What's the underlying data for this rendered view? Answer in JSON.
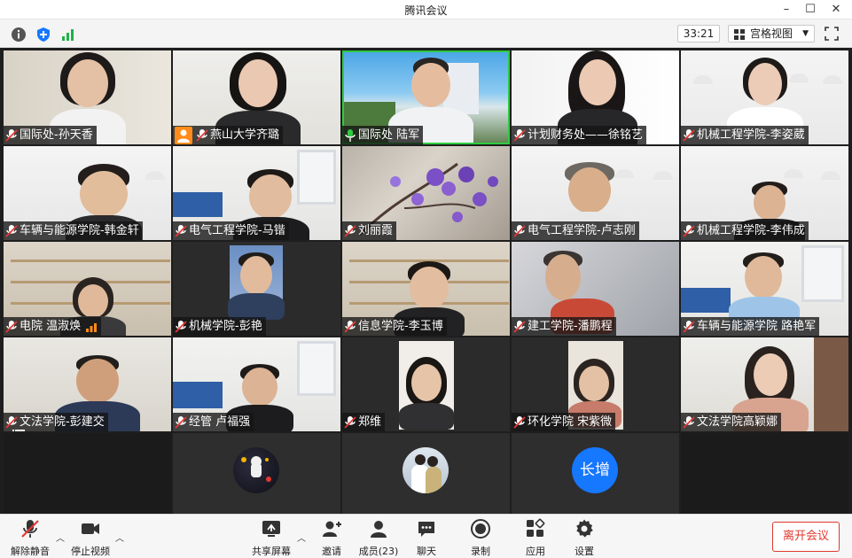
{
  "window": {
    "title": "腾讯会议"
  },
  "toolbar": {
    "timer": "33:21",
    "view_label": "宫格视图",
    "icons": [
      "info-icon",
      "security-shield-icon",
      "signal-icon",
      "fullscreen-icon"
    ]
  },
  "participants": [
    {
      "name": "国际处-孙天香"
    },
    {
      "name": "燕山大学齐璐"
    },
    {
      "name": "国际处 陆军",
      "speaking": true
    },
    {
      "name": "计划财务处——徐铭艺"
    },
    {
      "name": "机械工程学院-李姿葳"
    },
    {
      "name": "车辆与能源学院-韩金轩"
    },
    {
      "name": "电气工程学院-马锴"
    },
    {
      "name": "刘丽霞"
    },
    {
      "name": "电气工程学院-卢志刚"
    },
    {
      "name": "机械工程学院-李伟成"
    },
    {
      "name": "电院 温淑焕"
    },
    {
      "name": "机械学院-彭艳"
    },
    {
      "name": "信息学院-李玉博"
    },
    {
      "name": "建工学院-潘鹏程"
    },
    {
      "name": "车辆与能源学院 路艳军"
    },
    {
      "name": "文法学院-彭建交"
    },
    {
      "name": "经管 卢福强"
    },
    {
      "name": "郑维"
    },
    {
      "name": "环化学院 宋紫微"
    },
    {
      "name": "文法学院高颖娜"
    }
  ],
  "avatar_row": {
    "initials": "长增"
  },
  "bottombar": {
    "mute_label": "解除静音",
    "video_label": "停止视频",
    "share_label": "共享屏幕",
    "invite_label": "邀请",
    "members_label": "成员(23)",
    "chat_label": "聊天",
    "record_label": "录制",
    "apps_label": "应用",
    "settings_label": "设置",
    "leave_label": "离开会议"
  },
  "colors": {
    "accent_blue": "#1677ff",
    "leave_red": "#e0392f",
    "speaking_green": "#2ecc40"
  }
}
